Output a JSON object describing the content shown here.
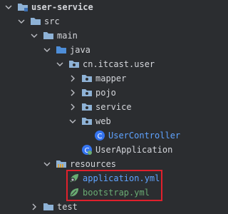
{
  "project_tree": {
    "root": "user-service",
    "src": "src",
    "main": "main",
    "java": "java",
    "package": "cn.itcast.user",
    "mapper": "mapper",
    "pojo": "pojo",
    "service": "service",
    "web": "web",
    "user_controller": "UserController",
    "user_application": "UserApplication",
    "resources": "resources",
    "application_yml": "application.yml",
    "bootstrap_yml": "bootstrap.yml",
    "test": "test"
  },
  "colors": {
    "background": "#2b2d30",
    "folder": "#8eb2d6",
    "class_file": "#5fa3ff",
    "yml_file": "#6aab73",
    "highlight_border": "#e0202c"
  }
}
